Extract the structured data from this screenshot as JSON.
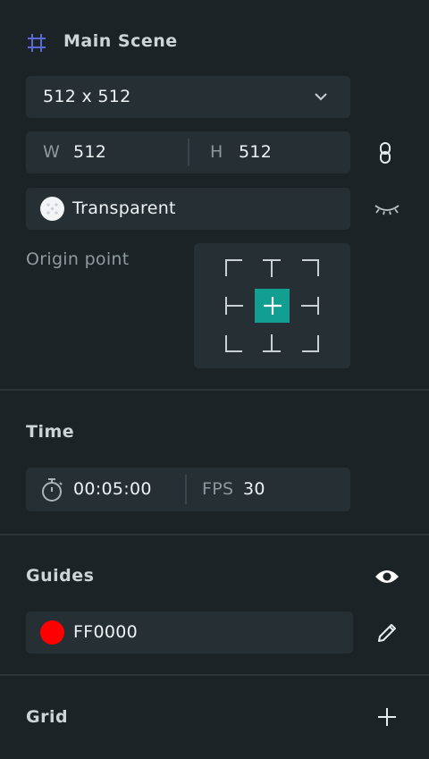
{
  "scene": {
    "title": "Main Scene",
    "size_select": "512 x 512",
    "width_label": "W",
    "width_value": "512",
    "height_label": "H",
    "height_value": "512",
    "background_label": "Transparent",
    "origin_label": "Origin point"
  },
  "time": {
    "title": "Time",
    "duration": "00:05:00",
    "fps_label": "FPS",
    "fps_value": "30"
  },
  "guides": {
    "title": "Guides",
    "color_hex": "FF0000",
    "swatch_color": "#ff0000"
  },
  "grid": {
    "title": "Grid"
  },
  "colors": {
    "accent": "#129e91",
    "frame_icon": "#5a6bd8",
    "background": "#1b2327",
    "field": "#262f34"
  },
  "icons": {
    "frame": "frame-icon",
    "dropdown": "chevron-down-icon",
    "link": "link-icon",
    "visibility_off": "eye-closed-icon",
    "timer": "stopwatch-icon",
    "visibility_on": "eye-icon",
    "edit": "pencil-icon",
    "add": "plus-icon"
  }
}
